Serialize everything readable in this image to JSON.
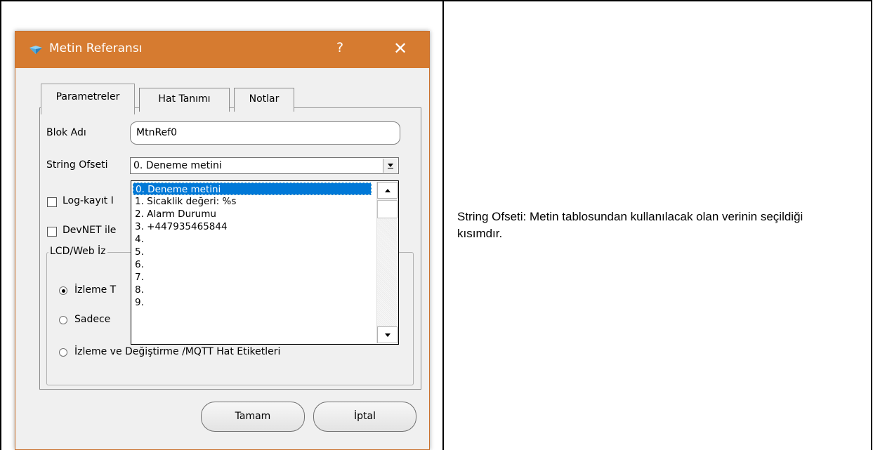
{
  "dialog": {
    "title": "Metin Referansı",
    "help_glyph": "?",
    "close_glyph": "✕"
  },
  "tabs": [
    {
      "label": "Parametreler",
      "active": true
    },
    {
      "label": "Hat Tanımı",
      "active": false
    },
    {
      "label": "Notlar",
      "active": false
    }
  ],
  "form": {
    "block_name_label": "Blok Adı",
    "block_name_value": "MtnRef0",
    "string_offset_label": "String Ofseti",
    "string_offset_value": "0. Deneme metini",
    "log_checkbox_label": "Log-kayıt I",
    "devnet_checkbox_label": "DevNET ile",
    "group_title": "LCD/Web İz",
    "radio_1_label": "İzleme T",
    "radio_2_label": "Sadece",
    "radio_3_label": "İzleme ve Değiştirme /MQTT Hat Etiketleri"
  },
  "dropdown_items": [
    "0. Deneme metini",
    "1. Sicaklik değeri: %s",
    "2. Alarm Durumu",
    "3.  +447935465844",
    "4.",
    "5.",
    "6.",
    "7.",
    "8.",
    "9."
  ],
  "buttons": {
    "ok": "Tamam",
    "cancel": "İptal"
  },
  "caption": "String Ofseti:  Metin tablosundan kullanılacak olan verinin seçildiği kısımdır.",
  "colors": {
    "titlebar": "#d67b30",
    "selection": "#0078d7"
  }
}
